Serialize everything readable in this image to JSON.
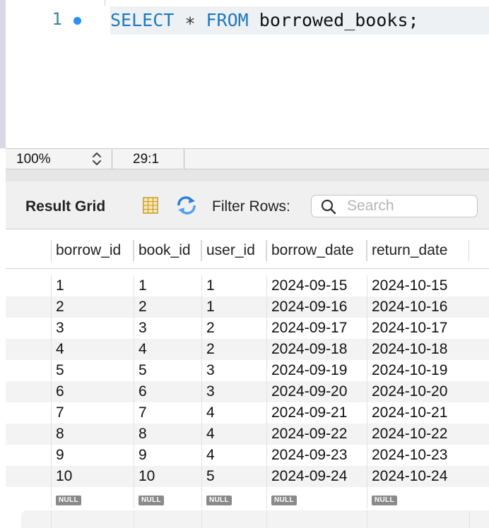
{
  "editor": {
    "line_number": "1",
    "code": {
      "kw1": "SELECT",
      "star": "∗",
      "kw2": "FROM",
      "rest": "borrowed_books;"
    }
  },
  "status": {
    "zoom": "100%",
    "cursor": "29:1"
  },
  "toolbar": {
    "result_grid": "Result Grid",
    "filter_rows": "Filter Rows:",
    "search_placeholder": "Search"
  },
  "colors": {
    "keyword": "#1d78c2",
    "line_number": "#3c7fa8",
    "bullet": "#2a8ff7"
  },
  "grid": {
    "columns": [
      "borrow_id",
      "book_id",
      "user_id",
      "borrow_date",
      "return_date"
    ],
    "rows": [
      [
        "1",
        "1",
        "1",
        "2024-09-15",
        "2024-10-15"
      ],
      [
        "2",
        "2",
        "1",
        "2024-09-16",
        "2024-10-16"
      ],
      [
        "3",
        "3",
        "2",
        "2024-09-17",
        "2024-10-17"
      ],
      [
        "4",
        "4",
        "2",
        "2024-09-18",
        "2024-10-18"
      ],
      [
        "5",
        "5",
        "3",
        "2024-09-19",
        "2024-10-19"
      ],
      [
        "6",
        "6",
        "3",
        "2024-09-20",
        "2024-10-20"
      ],
      [
        "7",
        "7",
        "4",
        "2024-09-21",
        "2024-10-21"
      ],
      [
        "8",
        "8",
        "4",
        "2024-09-22",
        "2024-10-22"
      ],
      [
        "9",
        "9",
        "4",
        "2024-09-23",
        "2024-10-23"
      ],
      [
        "10",
        "10",
        "5",
        "2024-09-24",
        "2024-10-24"
      ]
    ],
    "null_label": "NULL"
  }
}
